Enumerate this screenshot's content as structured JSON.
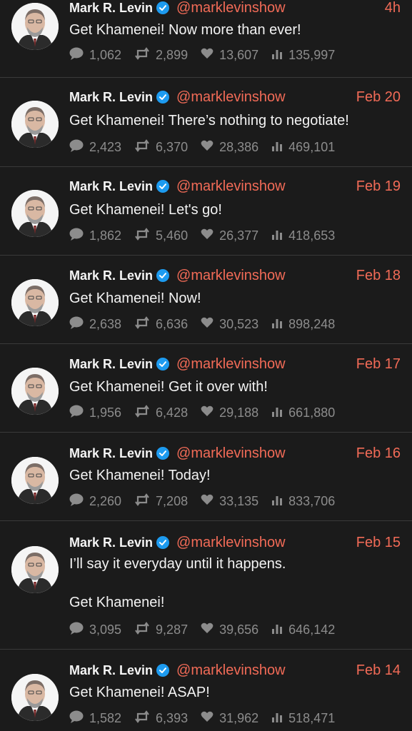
{
  "icons": {
    "verified": "verified-badge-icon",
    "reply": "reply-icon",
    "retweet": "retweet-icon",
    "like": "heart-icon",
    "views": "views-bar-icon"
  },
  "colors": {
    "accent": "#f26b57",
    "verified": "#1d9bf0",
    "muted": "#8c8c8c",
    "background": "#1b1b1b"
  },
  "tweets": [
    {
      "name": "Mark R. Levin",
      "handle": "@marklevinshow",
      "time": "4h",
      "text": "Get Khamenei! Now more than ever!",
      "replies": "1,062",
      "retweets": "2,899",
      "likes": "13,607",
      "views": "135,997"
    },
    {
      "name": "Mark R. Levin",
      "handle": "@marklevinshow",
      "time": "Feb 20",
      "text": "Get Khamenei! There’s nothing to negotiate!",
      "replies": "2,423",
      "retweets": "6,370",
      "likes": "28,386",
      "views": "469,101"
    },
    {
      "name": "Mark R. Levin",
      "handle": "@marklevinshow",
      "time": "Feb 19",
      "text": "Get Khamenei! Let's go!",
      "replies": "1,862",
      "retweets": "5,460",
      "likes": "26,377",
      "views": "418,653"
    },
    {
      "name": "Mark R. Levin",
      "handle": "@marklevinshow",
      "time": "Feb 18",
      "text": "Get Khamenei!  Now!",
      "replies": "2,638",
      "retweets": "6,636",
      "likes": "30,523",
      "views": "898,248"
    },
    {
      "name": "Mark R. Levin",
      "handle": "@marklevinshow",
      "time": "Feb 17",
      "text": "Get Khamenei! Get it over with!",
      "replies": "1,956",
      "retweets": "6,428",
      "likes": "29,188",
      "views": "661,880"
    },
    {
      "name": "Mark R. Levin",
      "handle": "@marklevinshow",
      "time": "Feb 16",
      "text": "Get Khamenei!  Today!",
      "replies": "2,260",
      "retweets": "7,208",
      "likes": "33,135",
      "views": "833,706"
    },
    {
      "name": "Mark R. Levin",
      "handle": "@marklevinshow",
      "time": "Feb 15",
      "text": "I’ll say it everyday until it happens.\n\nGet Khamenei!",
      "replies": "3,095",
      "retweets": "9,287",
      "likes": "39,656",
      "views": "646,142"
    },
    {
      "name": "Mark R. Levin",
      "handle": "@marklevinshow",
      "time": "Feb 14",
      "text": "Get Khamenei!  ASAP!",
      "replies": "1,582",
      "retweets": "6,393",
      "likes": "31,962",
      "views": "518,471"
    }
  ]
}
